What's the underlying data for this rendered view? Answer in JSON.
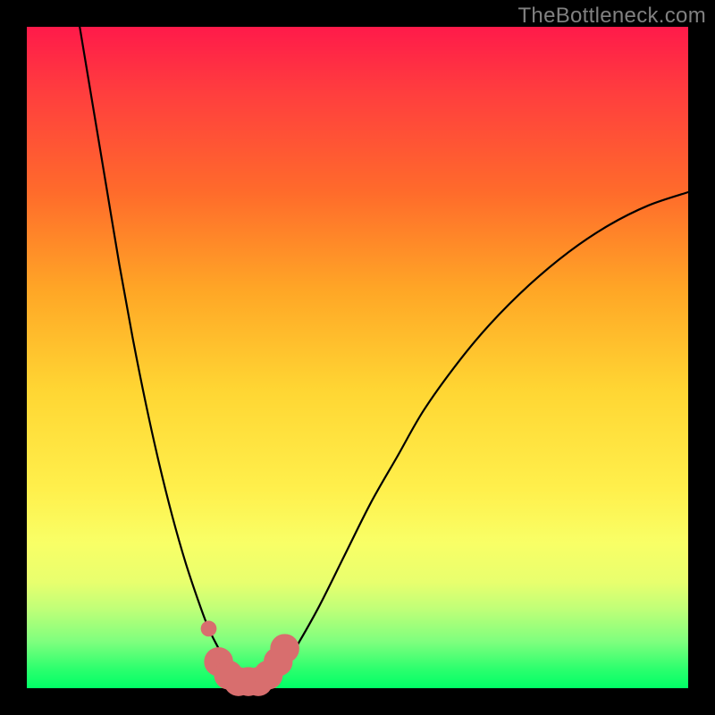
{
  "watermark": "TheBottleneck.com",
  "colors": {
    "stroke_line": "#000000",
    "marker_fill": "#d86e6e",
    "marker_stroke": "#c85a5a",
    "frame": "#000000"
  },
  "chart_data": {
    "type": "line",
    "title": "",
    "xlabel": "",
    "ylabel": "",
    "xlim": [
      0,
      100
    ],
    "ylim": [
      0,
      100
    ],
    "grid": false,
    "legend": false,
    "series": [
      {
        "name": "left-curve",
        "x": [
          8,
          10,
          12,
          14,
          16,
          18,
          20,
          22,
          24,
          26,
          27.5,
          29,
          30,
          30.5
        ],
        "y": [
          100,
          88,
          76,
          64,
          53,
          43,
          34,
          26,
          19,
          13,
          9,
          6,
          4,
          2
        ]
      },
      {
        "name": "right-curve",
        "x": [
          38,
          40,
          44,
          48,
          52,
          56,
          60,
          65,
          70,
          76,
          82,
          88,
          94,
          100
        ],
        "y": [
          2,
          5,
          12,
          20,
          28,
          35,
          42,
          49,
          55,
          61,
          66,
          70,
          73,
          75
        ]
      },
      {
        "name": "markers",
        "color": "#d86e6e",
        "points": [
          {
            "x": 27.5,
            "y": 9,
            "r": 1.2
          },
          {
            "x": 29,
            "y": 4,
            "r": 2.2
          },
          {
            "x": 30.5,
            "y": 2,
            "r": 2.2
          },
          {
            "x": 32,
            "y": 1,
            "r": 2.2
          },
          {
            "x": 33.5,
            "y": 1,
            "r": 2.2
          },
          {
            "x": 35,
            "y": 1,
            "r": 2.2
          },
          {
            "x": 36.5,
            "y": 2,
            "r": 2.2
          },
          {
            "x": 38,
            "y": 4,
            "r": 2.2
          },
          {
            "x": 39,
            "y": 6,
            "r": 2.2
          }
        ]
      }
    ]
  }
}
